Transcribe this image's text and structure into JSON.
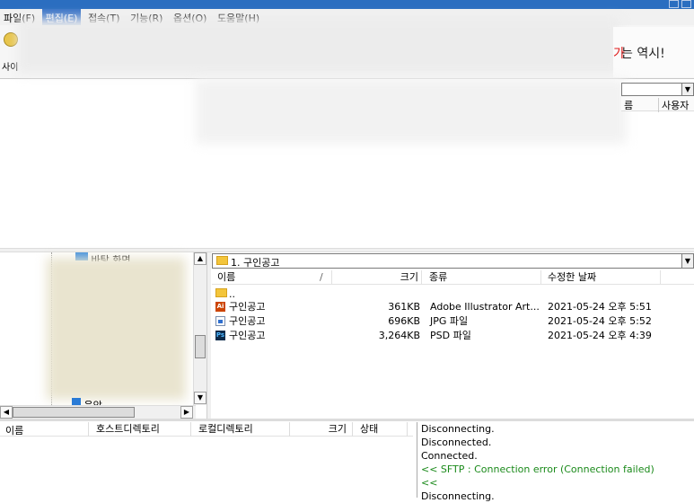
{
  "menu": {
    "items": [
      "파일(F)",
      "편집(E)",
      "접속(T)",
      "기능(R)",
      "옵션(O)",
      "도움말(H)"
    ],
    "active_index": 1
  },
  "toolbar": {
    "site_label": "사이",
    "banner_red": "가",
    "banner_text": "는 역시!"
  },
  "remote": {
    "columns": [
      "름",
      "사용자"
    ]
  },
  "tree": {
    "visible_item": "바탕 화면",
    "bottom_item": "음악"
  },
  "local": {
    "path": "1. 구인공고",
    "columns": {
      "name": "이름",
      "sort_mark": "/",
      "size": "크기",
      "type": "종류",
      "modified": "수정한 날짜"
    },
    "parent": "..",
    "files": [
      {
        "name": "구인공고",
        "size": "361KB",
        "type": "Adobe Illustrator Art...",
        "modified": "2021-05-24 오후 5:51",
        "icon": "illustrator-file-icon",
        "icon_text": "Ai",
        "icon_color": "#cc4400"
      },
      {
        "name": "구인공고",
        "size": "696KB",
        "type": "JPG 파일",
        "modified": "2021-05-24 오후 5:52",
        "icon": "jpg-file-icon",
        "icon_text": "",
        "icon_color": "#2f6fcf"
      },
      {
        "name": "구인공고",
        "size": "3,264KB",
        "type": "PSD 파일",
        "modified": "2021-05-24 오후 4:39",
        "icon": "photoshop-file-icon",
        "icon_text": "Ps",
        "icon_color": "#0b2a4a"
      }
    ]
  },
  "queue": {
    "columns": [
      "이름",
      "호스트디렉토리",
      "로컬디렉토리",
      "크기",
      "상태"
    ]
  },
  "log": {
    "lines": [
      {
        "text": "Disconnecting.",
        "color": "#000000"
      },
      {
        "text": "Disconnected.",
        "color": "#000000"
      },
      {
        "text": "Connected.",
        "color": "#000000"
      },
      {
        "text": "<< SFTP : Connection error (Connection failed)",
        "color": "#1a8a1a"
      },
      {
        "text": "<<",
        "color": "#1a8a1a"
      },
      {
        "text": "Disconnecting.",
        "color": "#000000"
      }
    ]
  }
}
